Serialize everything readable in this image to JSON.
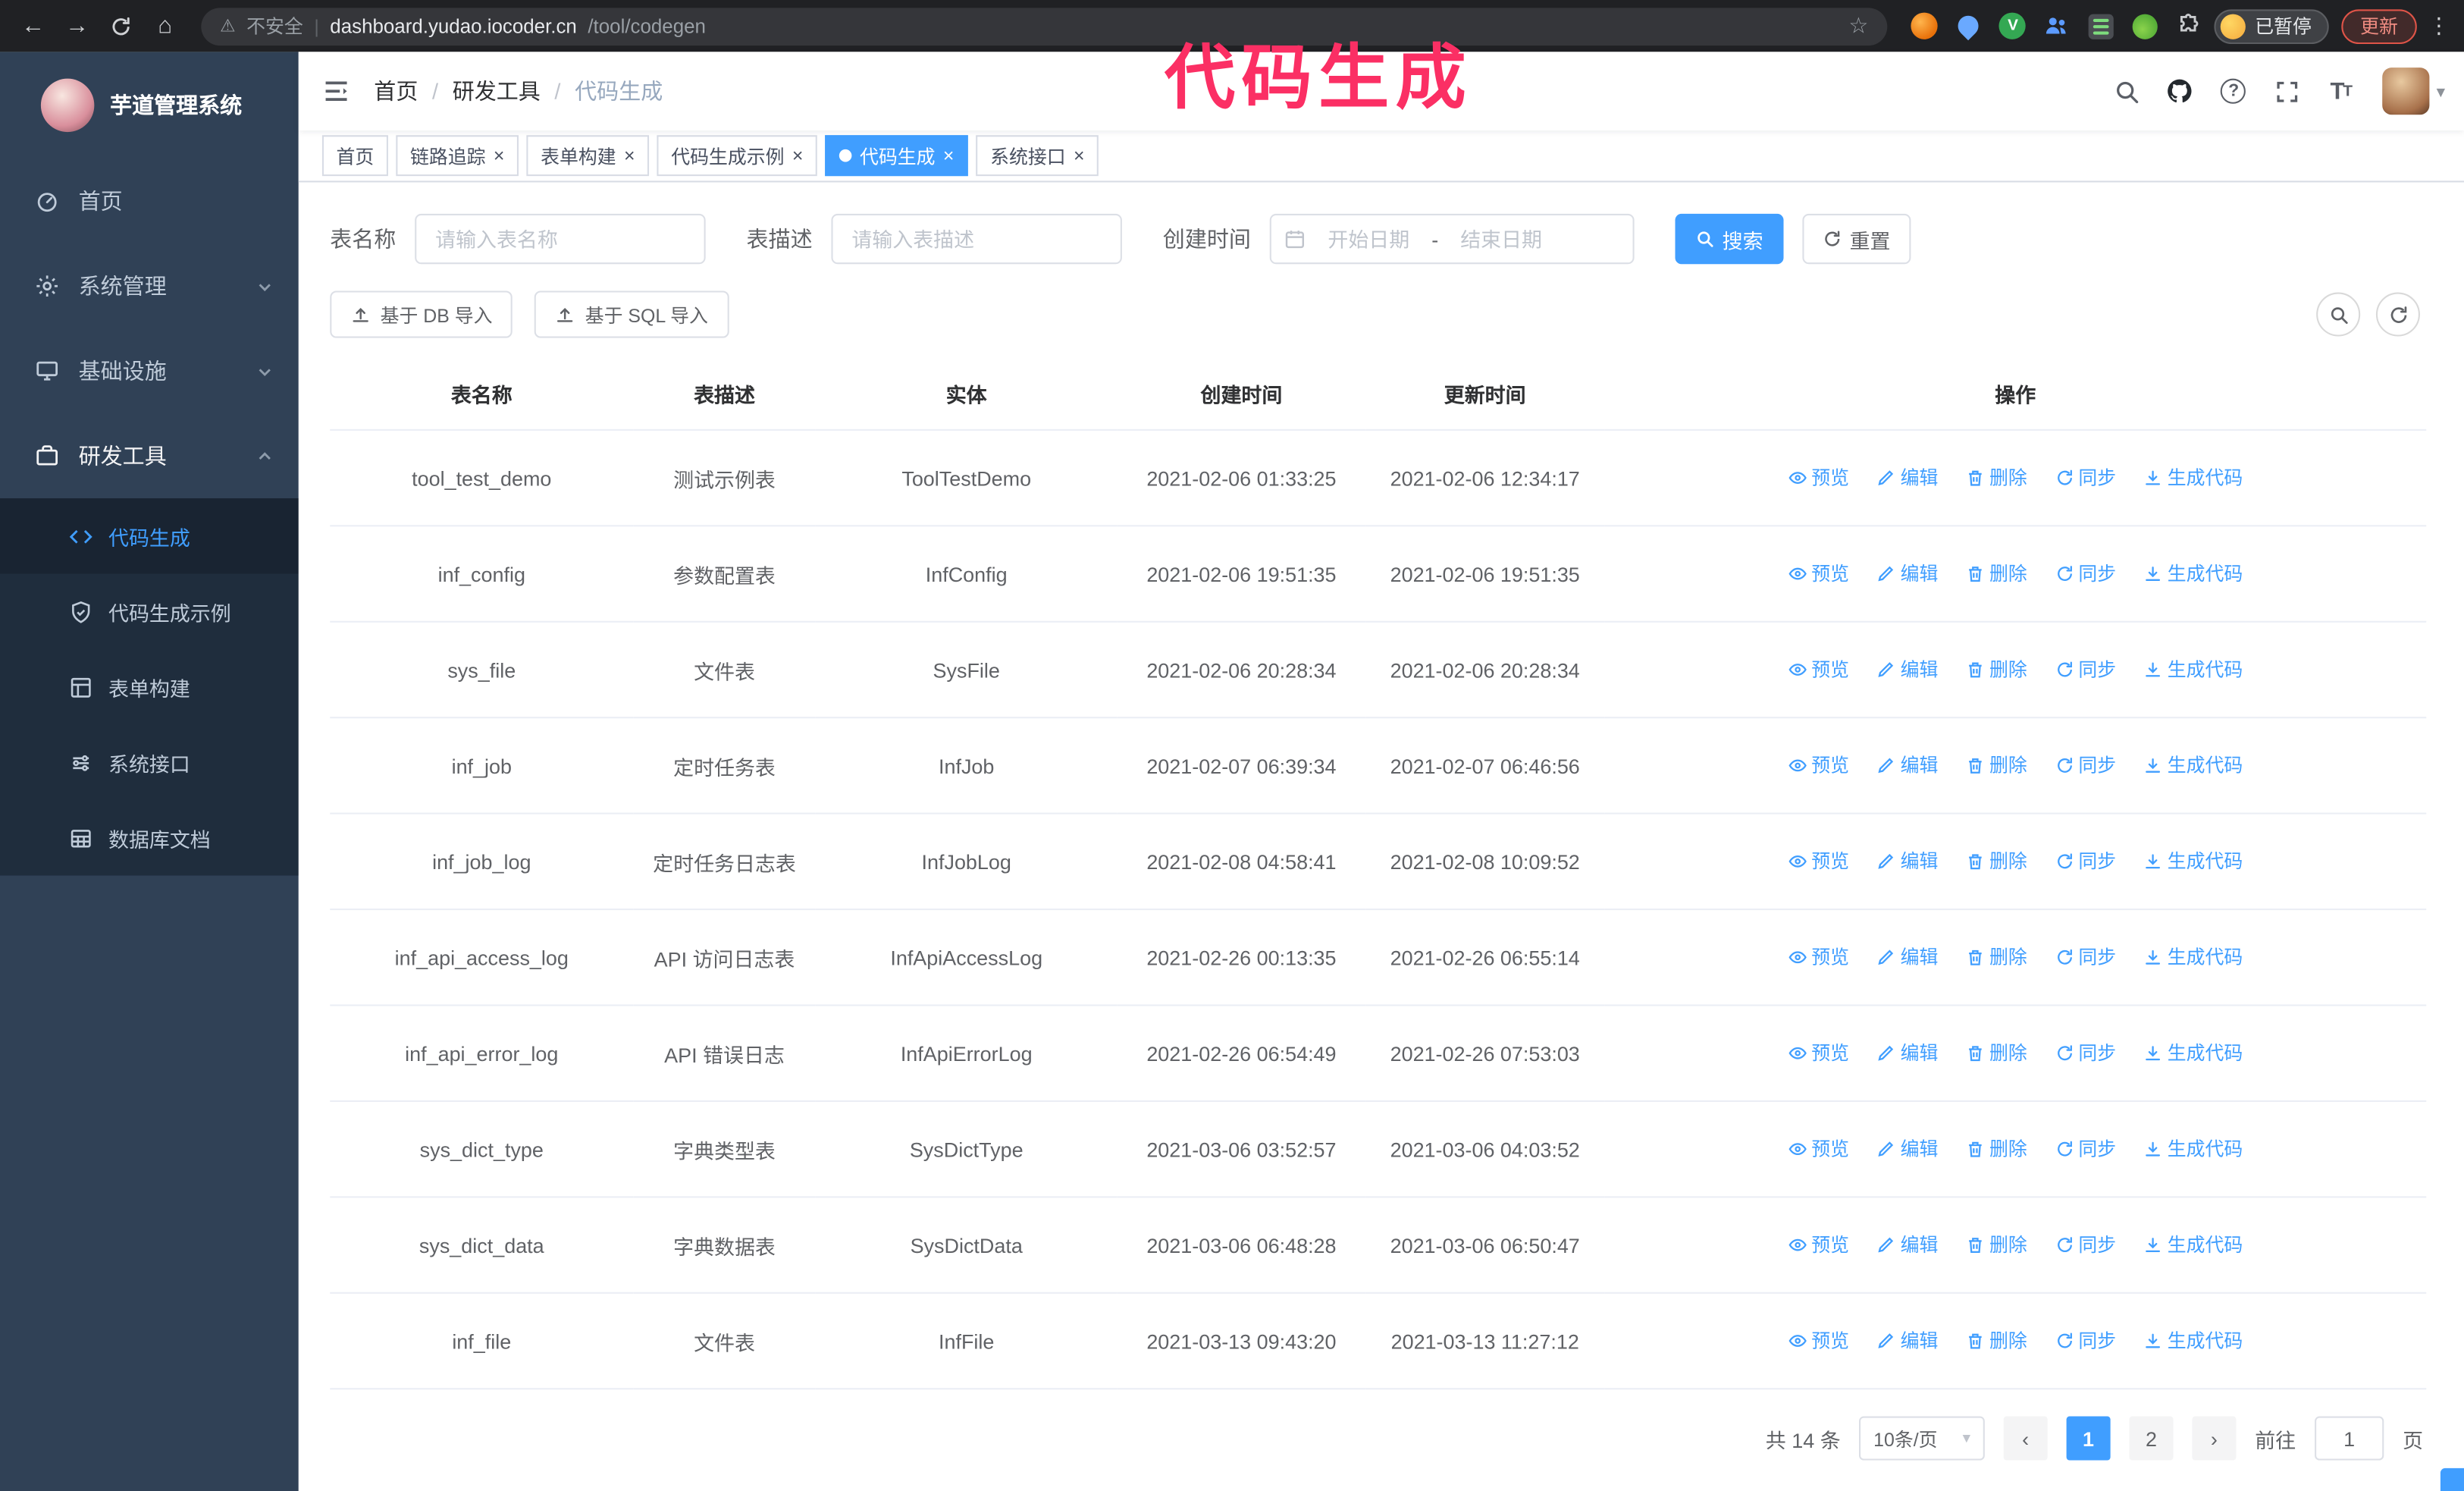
{
  "colors": {
    "accent": "#409eff",
    "sidebar_bg": "#304156",
    "overlay": "#fb2f64"
  },
  "overlay": {
    "text": "代码生成"
  },
  "glyphs": {
    "back": "←",
    "forward": "→",
    "home": "⌂",
    "star": "☆",
    "menu_dots": "⋮",
    "warning": "⚠",
    "divider": "|",
    "caret_down": "▾",
    "prev": "‹",
    "next": "›",
    "v_badge": "V"
  },
  "browser": {
    "security_label": "不安全",
    "url_host": "dashboard.yudao.iocoder.cn",
    "url_path": "/tool/codegen",
    "paused_badge": "已暂停",
    "update_button": "更新"
  },
  "sidebar": {
    "app_title": "芋道管理系统",
    "items": [
      {
        "label": "首页"
      },
      {
        "label": "系统管理"
      },
      {
        "label": "基础设施"
      },
      {
        "label": "研发工具"
      }
    ],
    "submenu": [
      {
        "label": "代码生成",
        "active": true
      },
      {
        "label": "代码生成示例"
      },
      {
        "label": "表单构建"
      },
      {
        "label": "系统接口"
      },
      {
        "label": "数据库文档"
      }
    ]
  },
  "header": {
    "breadcrumb": [
      "首页",
      "研发工具",
      "代码生成"
    ],
    "breadcrumb_separator": "/"
  },
  "tabs": [
    {
      "label": "首页",
      "closable": false,
      "active": false
    },
    {
      "label": "链路追踪",
      "closable": true,
      "active": false
    },
    {
      "label": "表单构建",
      "closable": true,
      "active": false
    },
    {
      "label": "代码生成示例",
      "closable": true,
      "active": false
    },
    {
      "label": "代码生成",
      "closable": true,
      "active": true
    },
    {
      "label": "系统接口",
      "closable": true,
      "active": false
    }
  ],
  "filters": {
    "table_name_label": "表名称",
    "table_name_placeholder": "请输入表名称",
    "table_desc_label": "表描述",
    "table_desc_placeholder": "请输入表描述",
    "create_time_label": "创建时间",
    "date_start_placeholder": "开始日期",
    "date_separator": "-",
    "date_end_placeholder": "结束日期",
    "search_button": "搜索",
    "reset_button": "重置"
  },
  "toolbar": {
    "import_db_button": "基于 DB 导入",
    "import_sql_button": "基于 SQL 导入"
  },
  "table": {
    "columns": [
      "表名称",
      "表描述",
      "实体",
      "创建时间",
      "更新时间",
      "操作"
    ],
    "ops": [
      "预览",
      "编辑",
      "删除",
      "同步",
      "生成代码"
    ],
    "rows": [
      {
        "name": "tool_test_demo",
        "desc": "测试示例表",
        "entity": "ToolTestDemo",
        "created": "2021-02-06 01:33:25",
        "updated": "2021-02-06 12:34:17"
      },
      {
        "name": "inf_config",
        "desc": "参数配置表",
        "entity": "InfConfig",
        "created": "2021-02-06 19:51:35",
        "updated": "2021-02-06 19:51:35"
      },
      {
        "name": "sys_file",
        "desc": "文件表",
        "entity": "SysFile",
        "created": "2021-02-06 20:28:34",
        "updated": "2021-02-06 20:28:34"
      },
      {
        "name": "inf_job",
        "desc": "定时任务表",
        "entity": "InfJob",
        "created": "2021-02-07 06:39:34",
        "updated": "2021-02-07 06:46:56"
      },
      {
        "name": "inf_job_log",
        "desc": "定时任务日志表",
        "entity": "InfJobLog",
        "created": "2021-02-08 04:58:41",
        "updated": "2021-02-08 10:09:52"
      },
      {
        "name": "inf_api_access_log",
        "desc": "API 访问日志表",
        "entity": "InfApiAccessLog",
        "created": "2021-02-26 00:13:35",
        "updated": "2021-02-26 06:55:14"
      },
      {
        "name": "inf_api_error_log",
        "desc": "API 错误日志",
        "entity": "InfApiErrorLog",
        "created": "2021-02-26 06:54:49",
        "updated": "2021-02-26 07:53:03"
      },
      {
        "name": "sys_dict_type",
        "desc": "字典类型表",
        "entity": "SysDictType",
        "created": "2021-03-06 03:52:57",
        "updated": "2021-03-06 04:03:52"
      },
      {
        "name": "sys_dict_data",
        "desc": "字典数据表",
        "entity": "SysDictData",
        "created": "2021-03-06 06:48:28",
        "updated": "2021-03-06 06:50:47"
      },
      {
        "name": "inf_file",
        "desc": "文件表",
        "entity": "InfFile",
        "created": "2021-03-13 09:43:20",
        "updated": "2021-03-13 11:27:12"
      }
    ]
  },
  "pagination": {
    "total_text": "共 14 条",
    "page_size": "10条/页",
    "pages": [
      "1",
      "2"
    ],
    "goto_label": "前往",
    "goto_value": "1",
    "page_suffix": "页"
  }
}
